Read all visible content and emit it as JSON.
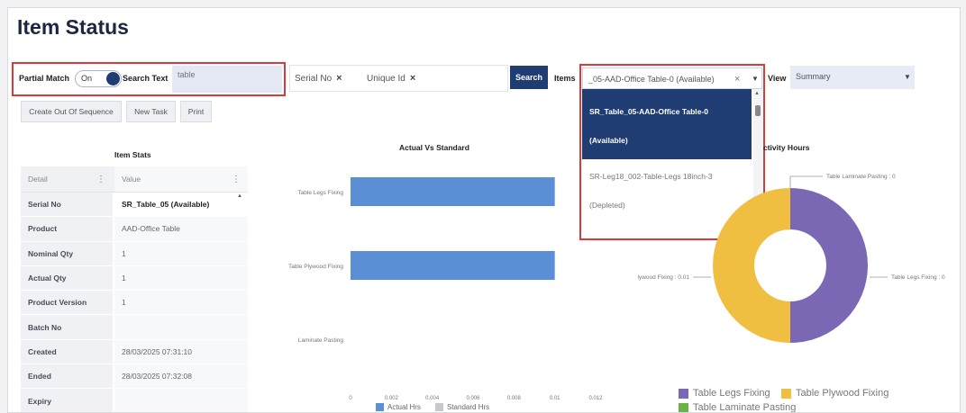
{
  "page": {
    "title": "Item Status"
  },
  "search": {
    "partial_match_label": "Partial Match",
    "toggle_text": "On",
    "search_text_label": "Search Text",
    "search_text_value": "table",
    "chips": [
      "Serial No",
      "Unique Id"
    ],
    "chip_close": "×",
    "search_button": "Search",
    "items_label": "Items",
    "items_selected": "_05-AAD-Office Table-0 (Available)",
    "items_clear": "×",
    "view_label": "View",
    "view_value": "Summary"
  },
  "actions": [
    "Create Out Of Sequence",
    "New Task",
    "Print"
  ],
  "items_dropdown": {
    "options": [
      {
        "line1": "SR_Table_05-AAD-Office Table-0",
        "line2": "(Available)",
        "selected": true
      },
      {
        "line1": "SR-Leg18_002-Table-Legs 18inch-3",
        "line2": "(Depleted)",
        "selected": false
      }
    ]
  },
  "item_stats": {
    "title": "Item Stats",
    "headers": [
      "Detail",
      "Value"
    ],
    "rows": [
      {
        "detail": "Serial No",
        "value": "SR_Table_05 (Available)"
      },
      {
        "detail": "Product",
        "value": "AAD-Office Table"
      },
      {
        "detail": "Nominal Qty",
        "value": "1"
      },
      {
        "detail": "Actual Qty",
        "value": "1"
      },
      {
        "detail": "Product Version",
        "value": "1"
      },
      {
        "detail": "Batch No",
        "value": ""
      },
      {
        "detail": "Created",
        "value": "28/03/2025 07:31:10"
      },
      {
        "detail": "Ended",
        "value": "28/03/2025 07:32:08"
      },
      {
        "detail": "Expiry",
        "value": ""
      }
    ]
  },
  "chart_data": [
    {
      "type": "bar",
      "orientation": "horizontal",
      "title": "Actual Vs Standard",
      "categories": [
        "Table Legs Fixing",
        "Table Plywood Fixing",
        "Laminate Pasting"
      ],
      "series": [
        {
          "name": "Actual Hrs",
          "color": "#5a8fd6",
          "values": [
            0.01,
            0.01,
            0
          ]
        },
        {
          "name": "Standard Hrs",
          "color": "#c8c8cc",
          "values": [
            0,
            0,
            0
          ]
        }
      ],
      "xticks": [
        "0",
        "0.002",
        "0.004",
        "0.006",
        "0.008",
        "0.01",
        "0.012"
      ],
      "xlim": [
        0,
        0.012
      ]
    },
    {
      "type": "pie",
      "title": "ctivity Hours",
      "slices": [
        {
          "name": "Table Legs Fixing",
          "label": "Table Legs Fixing : 0",
          "value": 0.01,
          "color": "#7b68b4"
        },
        {
          "name": "Table Plywood Fixing",
          "label": "lywood Fixing : 0.01",
          "value": 0.01,
          "color": "#f0bf42"
        },
        {
          "name": "Table Laminate Pasting",
          "label": "Table Laminate Pasting : 0",
          "value": 0,
          "color": "#67b346"
        }
      ]
    }
  ]
}
